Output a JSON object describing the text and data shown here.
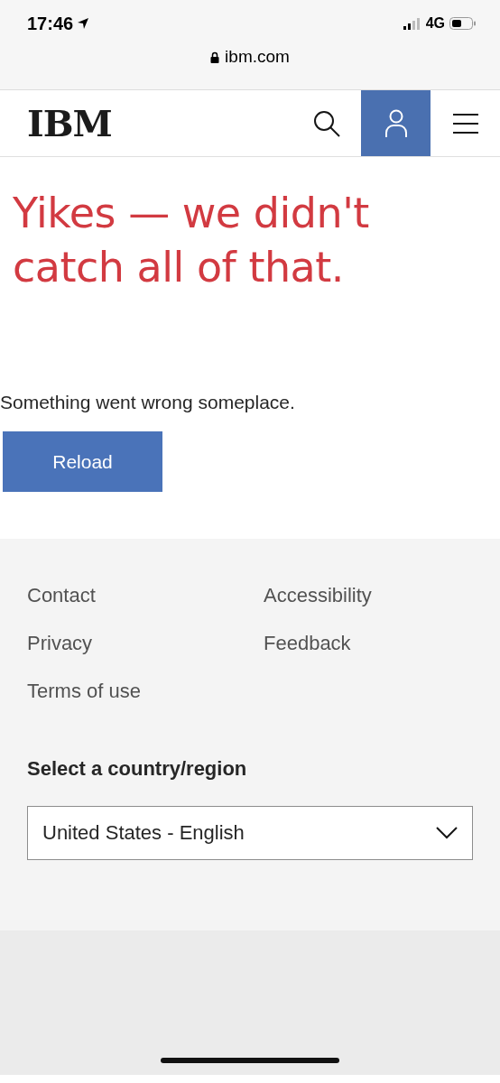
{
  "status_bar": {
    "time": "17:46",
    "network": "4G"
  },
  "address_bar": {
    "url": "ibm.com"
  },
  "header": {
    "logo": "IBM"
  },
  "error": {
    "title": "Yikes — we didn't catch all of that.",
    "message": "Something went wrong someplace.",
    "button": "Reload"
  },
  "footer": {
    "links": [
      {
        "label": "Contact"
      },
      {
        "label": "Accessibility"
      },
      {
        "label": "Privacy"
      },
      {
        "label": "Feedback"
      },
      {
        "label": "Terms of use"
      }
    ],
    "country_label": "Select a country/region",
    "country_value": "United States - English"
  }
}
